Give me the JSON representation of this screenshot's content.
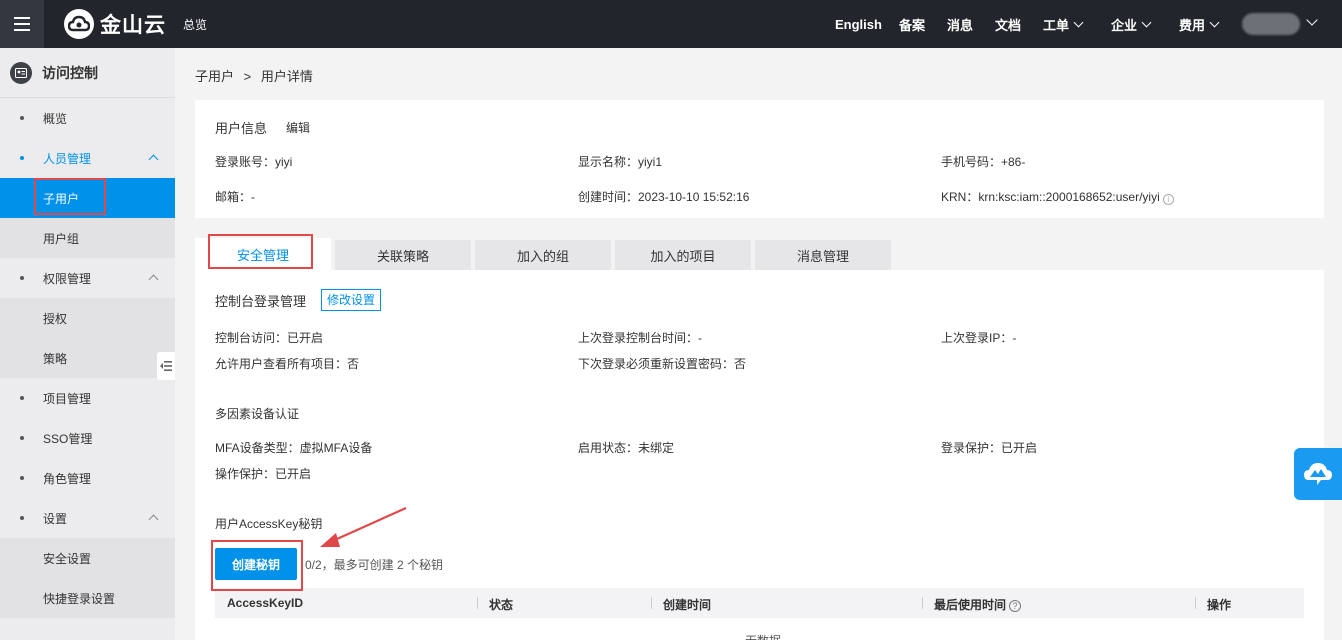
{
  "topbar": {
    "logo_text": "金山云",
    "overview": "总览",
    "nav": [
      {
        "label": "English",
        "has_dropdown": false
      },
      {
        "label": "备案",
        "has_dropdown": false
      },
      {
        "label": "消息",
        "has_dropdown": false
      },
      {
        "label": "文档",
        "has_dropdown": false
      },
      {
        "label": "工单",
        "has_dropdown": true
      },
      {
        "label": "企业",
        "has_dropdown": true
      },
      {
        "label": "费用",
        "has_dropdown": true
      }
    ]
  },
  "sidebar": {
    "title": "访问控制",
    "items": [
      {
        "label": "概览"
      },
      {
        "label": "人员管理"
      },
      {
        "label": "子用户"
      },
      {
        "label": "用户组"
      },
      {
        "label": "权限管理"
      },
      {
        "label": "授权"
      },
      {
        "label": "策略"
      },
      {
        "label": "项目管理"
      },
      {
        "label": "SSO管理"
      },
      {
        "label": "角色管理"
      },
      {
        "label": "设置"
      },
      {
        "label": "安全设置"
      },
      {
        "label": "快捷登录设置"
      }
    ]
  },
  "breadcrumb": {
    "parent": "子用户",
    "sep": ">",
    "current": "用户详情"
  },
  "user_info": {
    "title": "用户信息",
    "edit": "编辑",
    "login_account": "登录账号：yiyi",
    "display_name": "显示名称：yiyi1",
    "phone": "手机号码：+86-",
    "email": "邮箱：-",
    "created": "创建时间：2023-10-10 15:52:16",
    "krn": "KRN：krn:ksc:iam::2000168652:user/yiyi"
  },
  "tabs": [
    "安全管理",
    "关联策略",
    "加入的组",
    "加入的项目",
    "消息管理"
  ],
  "console_login": {
    "title": "控制台登录管理",
    "modify": "修改设置",
    "access": "控制台访问：已开启",
    "last_login_time": "上次登录控制台时间：-",
    "last_ip": "上次登录IP：-",
    "view_all_projects": "允许用户查看所有项目：否",
    "reset_password": "下次登录必须重新设置密码：否"
  },
  "mfa": {
    "title": "多因素设备认证",
    "device_type": "MFA设备类型：虚拟MFA设备",
    "status": "启用状态：未绑定",
    "login_protect": "登录保护：已开启",
    "op_protect": "操作保护：已开启"
  },
  "access_key": {
    "title": "用户AccessKey秘钥",
    "create_btn": "创建秘钥",
    "hint": "0/2，最多可创建 2 个秘钥",
    "columns": [
      "AccessKeyID",
      "状态",
      "创建时间",
      "最后使用时间",
      "操作"
    ],
    "empty": "无数据"
  },
  "colors": {
    "accent": "#0091ea",
    "topbar": "#22252b",
    "highlight": "#e1484a"
  }
}
